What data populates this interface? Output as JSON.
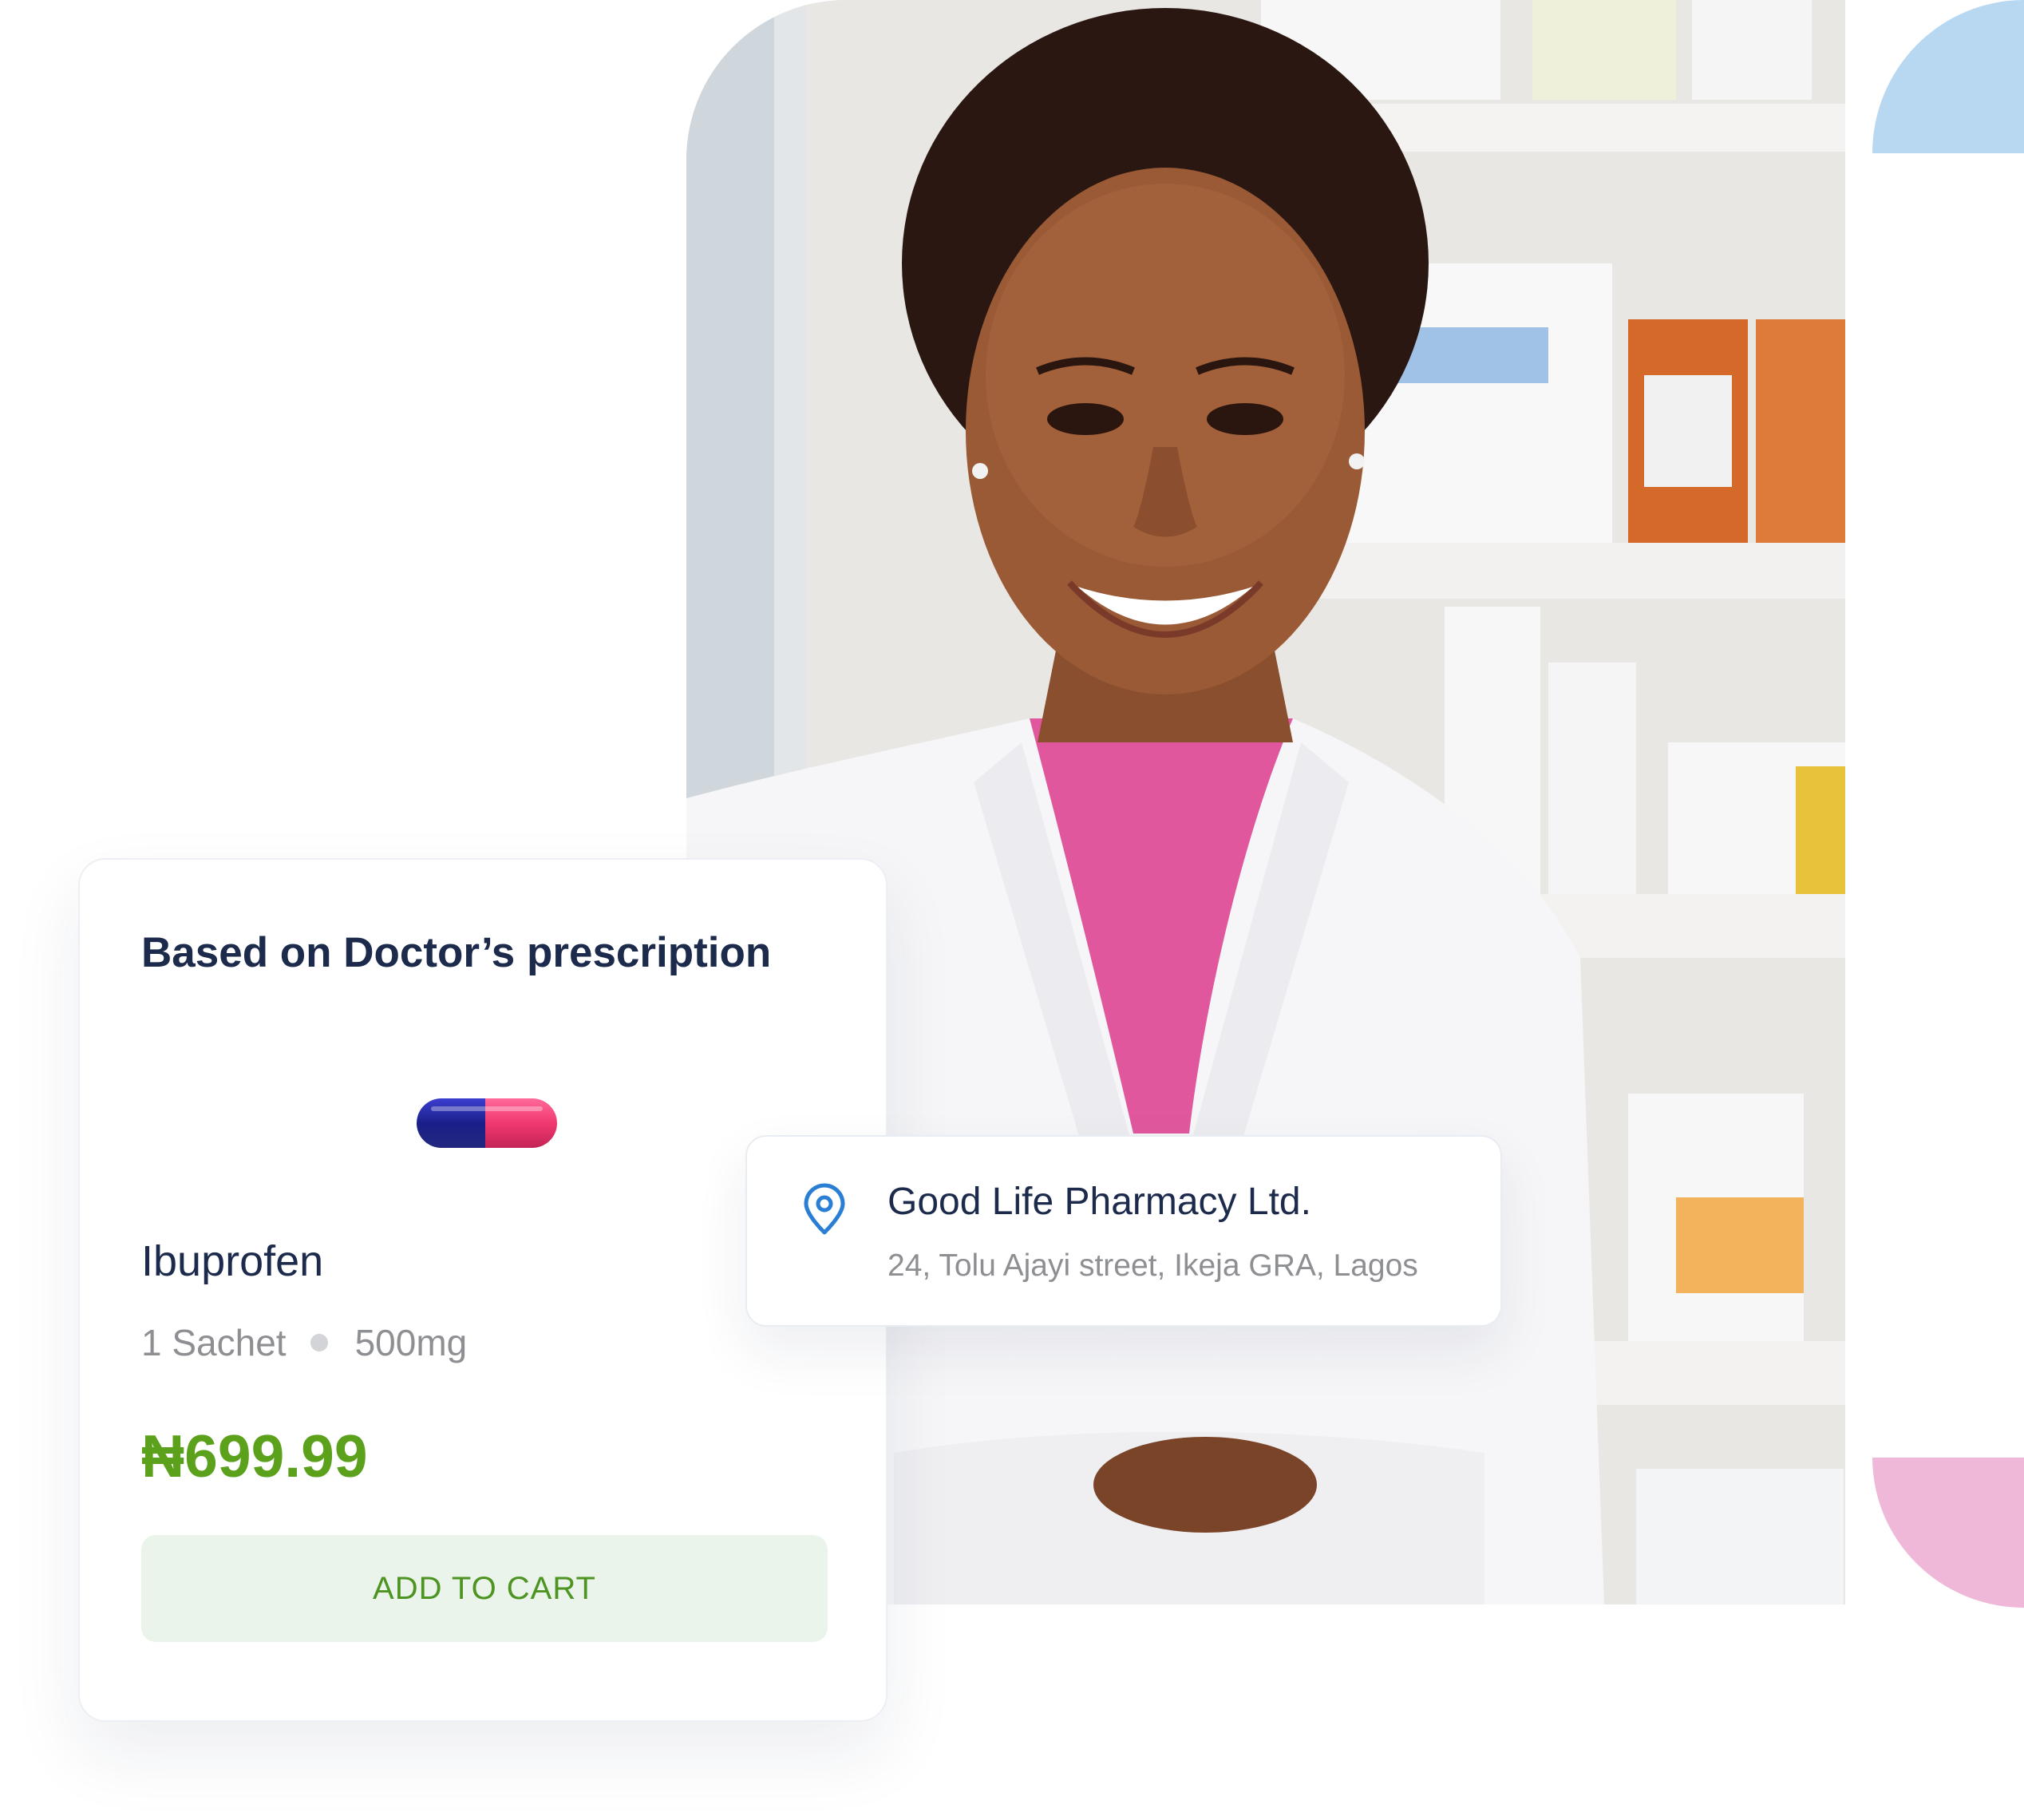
{
  "product_card": {
    "heading": "Based on Doctor’s prescription",
    "product_name": "Ibuprofen",
    "quantity": "1 Sachet",
    "dosage": "500mg",
    "price": "₦699.99",
    "add_to_cart_label": "ADD TO CART",
    "pill_icon": "capsule-icon"
  },
  "location_card": {
    "icon": "location-pin-icon",
    "pharmacy_name": "Good Life Pharmacy Ltd.",
    "address": "24, Tolu Ajayi street, Ikeja GRA, Lagos"
  },
  "colors": {
    "heading": "#1c2a4c",
    "price": "#5ba11c",
    "button_bg": "#eaf4ea",
    "button_text": "#4e9422",
    "accent_blue": "#b8d7f1",
    "accent_pink": "#efb8d9",
    "pin": "#2a7fd4"
  }
}
